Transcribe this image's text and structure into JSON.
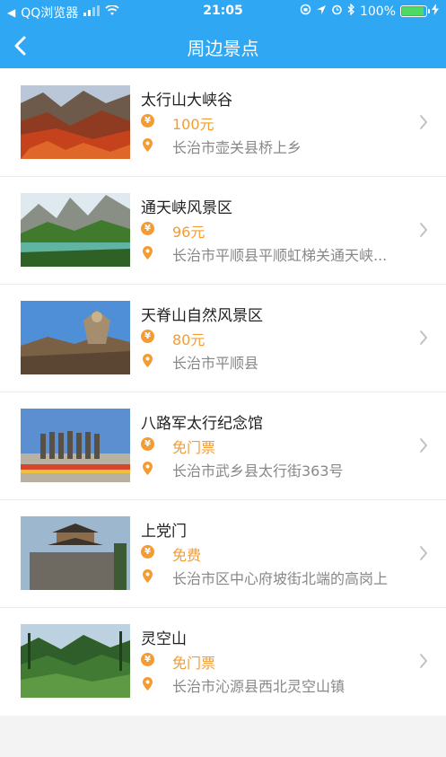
{
  "status": {
    "carrier": "QQ浏览器",
    "time": "21:05",
    "battery": "100%"
  },
  "header": {
    "title": "周边景点"
  },
  "colors": {
    "header": "#2fa7f2",
    "price": "#f39c34",
    "address": "#888888"
  },
  "spots": [
    {
      "name": "太行山大峡谷",
      "price": "100元",
      "address": "长治市壶关县桥上乡"
    },
    {
      "name": "通天峡风景区",
      "price": "96元",
      "address": "长治市平顺县平顺虹梯关通天峡..."
    },
    {
      "name": "天脊山自然风景区",
      "price": "80元",
      "address": "长治市平顺县"
    },
    {
      "name": "八路军太行纪念馆",
      "price": "免门票",
      "address": "长治市武乡县太行街363号"
    },
    {
      "name": "上党门",
      "price": "免费",
      "address": "长治市区中心府坡街北端的高岗上"
    },
    {
      "name": "灵空山",
      "price": "免门票",
      "address": "长治市沁源县西北灵空山镇"
    }
  ]
}
